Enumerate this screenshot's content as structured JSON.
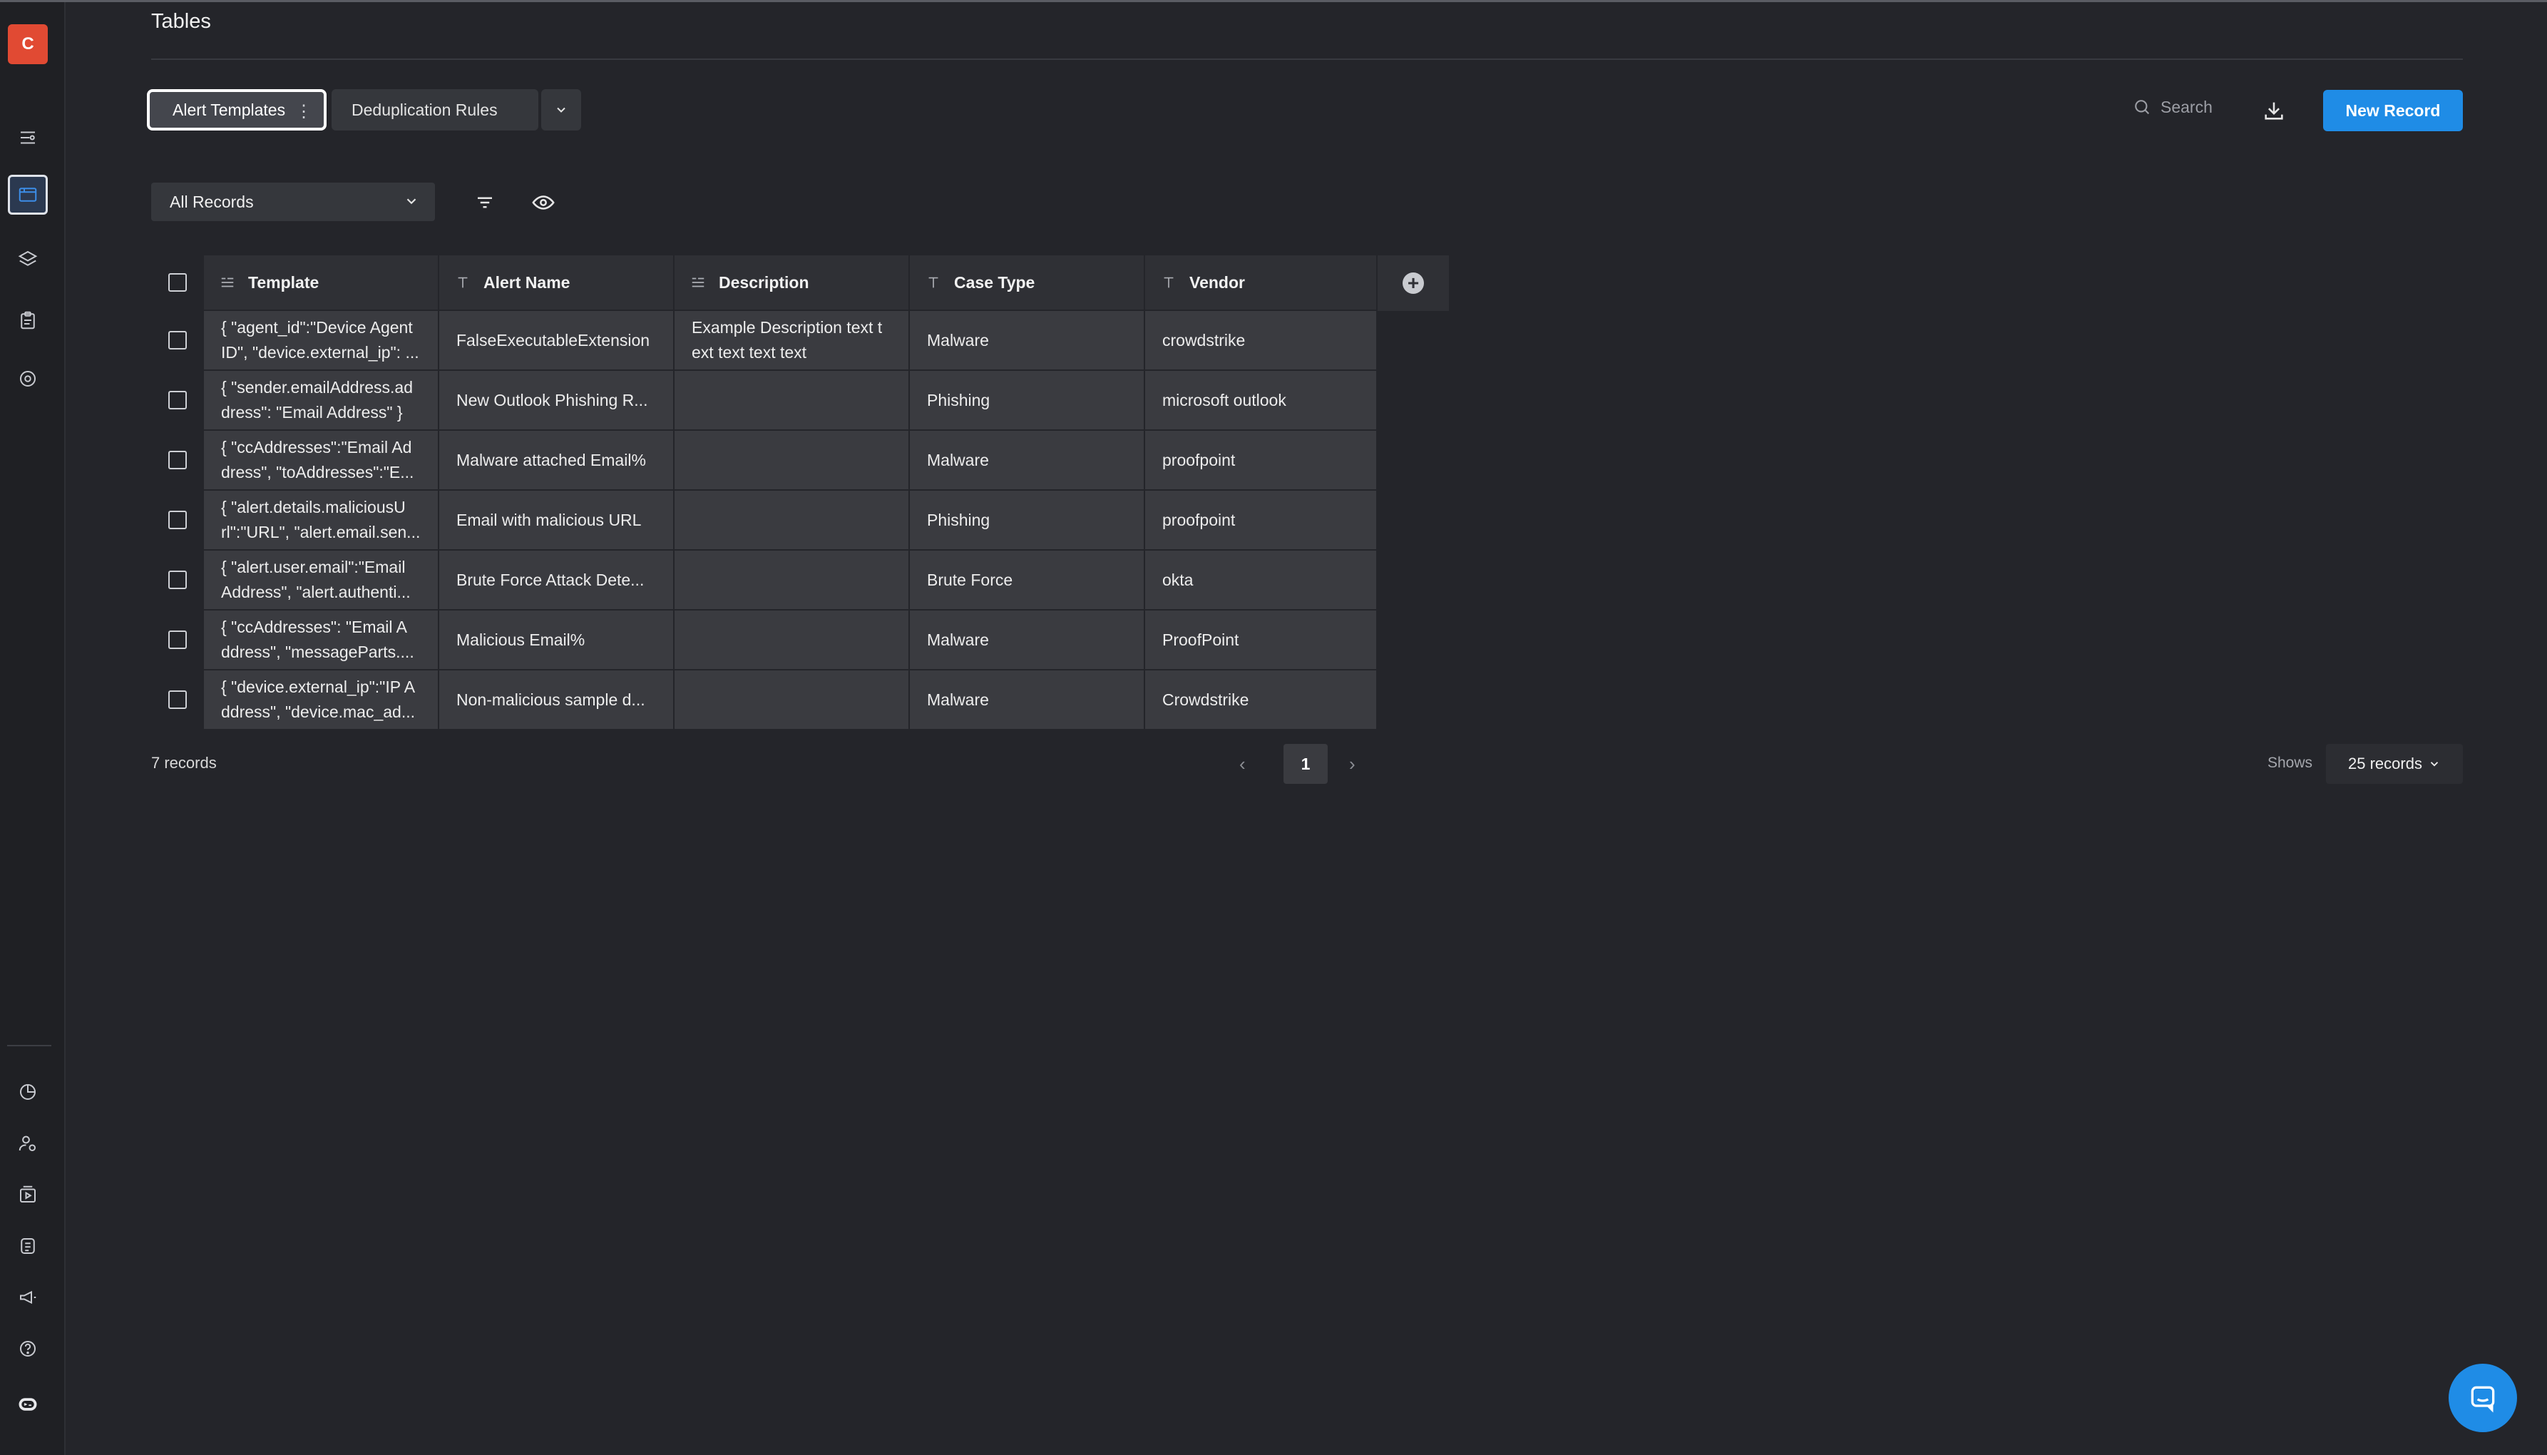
{
  "app": {
    "avatar_letter": "C",
    "accent_color": "#1f8ce6",
    "avatar_color": "#e14a33"
  },
  "sidebar": {
    "top_icons": [
      "workflow-icon",
      "tables-icon",
      "layers-icon",
      "clipboard-icon",
      "target-icon"
    ],
    "active": "tables-icon",
    "bottom_icons": [
      "analytics-icon",
      "users-settings-icon",
      "media-icon",
      "receipt-icon",
      "megaphone-icon",
      "help-icon",
      "bot-icon"
    ]
  },
  "header": {
    "title": "Tables"
  },
  "tabs": [
    {
      "label": "Alert Templates",
      "active": true
    },
    {
      "label": "Deduplication Rules",
      "active": false
    }
  ],
  "toolbar": {
    "search_placeholder": "Search",
    "new_record_label": "New Record"
  },
  "view": {
    "selected": "All Records"
  },
  "table": {
    "columns": [
      {
        "label": "Template",
        "type": "long-text"
      },
      {
        "label": "Alert Name",
        "type": "text"
      },
      {
        "label": "Description",
        "type": "long-text"
      },
      {
        "label": "Case Type",
        "type": "text"
      },
      {
        "label": "Vendor",
        "type": "text"
      }
    ],
    "rows": [
      {
        "template": "{ \"agent_id\":\"Device Agent ID\", \"device.external_ip\": ...",
        "alert_name": "FalseExecutableExtension",
        "description": "Example Description text t ext text text text",
        "case_type": "Malware",
        "vendor": "crowdstrike"
      },
      {
        "template": "{ \"sender.emailAddress.ad dress\": \"Email Address\" }",
        "alert_name": "New Outlook Phishing R...",
        "description": "",
        "case_type": "Phishing",
        "vendor": "microsoft outlook"
      },
      {
        "template": "{ \"ccAddresses\":\"Email Ad dress\", \"toAddresses\":\"E...",
        "alert_name": "Malware attached Email%",
        "description": "",
        "case_type": "Malware",
        "vendor": "proofpoint"
      },
      {
        "template": "{ \"alert.details.maliciousU rl\":\"URL\", \"alert.email.sen...",
        "alert_name": "Email with malicious URL",
        "description": "",
        "case_type": "Phishing",
        "vendor": "proofpoint"
      },
      {
        "template": "{ \"alert.user.email\":\"Email Address\", \"alert.authenti...",
        "alert_name": "Brute Force Attack Dete...",
        "description": "",
        "case_type": "Brute Force",
        "vendor": "okta"
      },
      {
        "template": "{ \"ccAddresses\": \"Email A ddress\", \"messageParts....",
        "alert_name": "Malicious Email%",
        "description": "",
        "case_type": "Malware",
        "vendor": "ProofPoint"
      },
      {
        "template": "{ \"device.external_ip\":\"IP A ddress\", \"device.mac_ad...",
        "alert_name": "Non-malicious sample d...",
        "description": "",
        "case_type": "Malware",
        "vendor": "Crowdstrike"
      }
    ]
  },
  "footer": {
    "records_count": "7 records",
    "current_page": "1",
    "shows_label": "Shows",
    "page_size": "25 records"
  }
}
